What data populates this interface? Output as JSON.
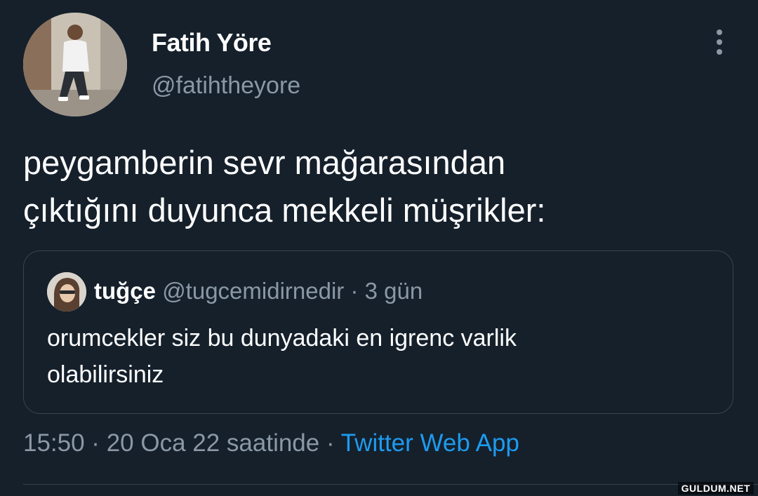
{
  "tweet": {
    "author_name": "Fatih Yöre",
    "author_handle": "@fatihtheyore",
    "text_line1": "peygamberin sevr mağarasından",
    "text_line2": "çıktığını duyunca mekkeli müşrikler:",
    "timestamp": "15:50 · 20 Oca 22 saatinde",
    "separator": " · ",
    "source": "Twitter Web App"
  },
  "quoted_tweet": {
    "author_name": "tuğçe",
    "author_handle": "@tugcemidirnedir",
    "time_ago": " · 3 gün",
    "text_line1": "orumcekler siz bu dunyadaki en igrenc varlik",
    "text_line2": "olabilirsiniz"
  },
  "watermark": "GULDUM.NET",
  "colors": {
    "background": "#15202b",
    "secondary_text": "#8b98a5",
    "link": "#1d9bf0",
    "border": "#38444d"
  },
  "icons": {
    "more": "more-vertical-icon"
  }
}
